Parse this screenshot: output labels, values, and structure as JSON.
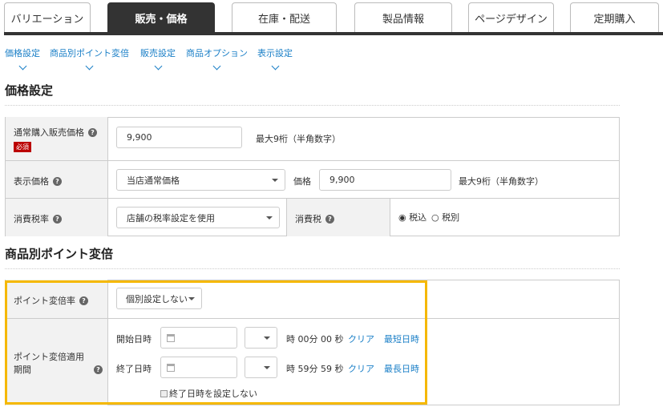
{
  "tabs": [
    "バリエーション",
    "販売・価格",
    "在庫・配送",
    "製品情報",
    "ページデザイン",
    "定期購入"
  ],
  "subnav": [
    "価格設定",
    "商品別ポイント変倍",
    "販売設定",
    "商品オプション",
    "表示設定"
  ],
  "section1": {
    "title": "価格設定",
    "regular_price": {
      "label": "通常購入販売価格",
      "required": "必須",
      "value": "9,900",
      "hint": "最大9桁（半角数字）"
    },
    "display_price": {
      "label": "表示価格",
      "select": "当店通常価格",
      "price_label": "価格",
      "value": "9,900",
      "hint": "最大9桁（半角数字）"
    },
    "tax_rate": {
      "label": "消費税率",
      "select": "店舗の税率設定を使用",
      "tax_label": "消費税",
      "options": [
        "税込",
        "税別"
      ],
      "selected": "税込"
    }
  },
  "section2": {
    "title": "商品別ポイント変倍",
    "rate": {
      "label": "ポイント変倍率",
      "select": "個別設定しない"
    },
    "period": {
      "label": "ポイント変倍適用期間",
      "start": {
        "label": "開始日時",
        "time": "時 00分 00 秒",
        "clear": "クリア",
        "quick": "最短日時"
      },
      "end": {
        "label": "終了日時",
        "time": "時 59分 59 秒",
        "clear": "クリア",
        "quick": "最長日時"
      },
      "no_end": "終了日時を設定しない"
    }
  }
}
